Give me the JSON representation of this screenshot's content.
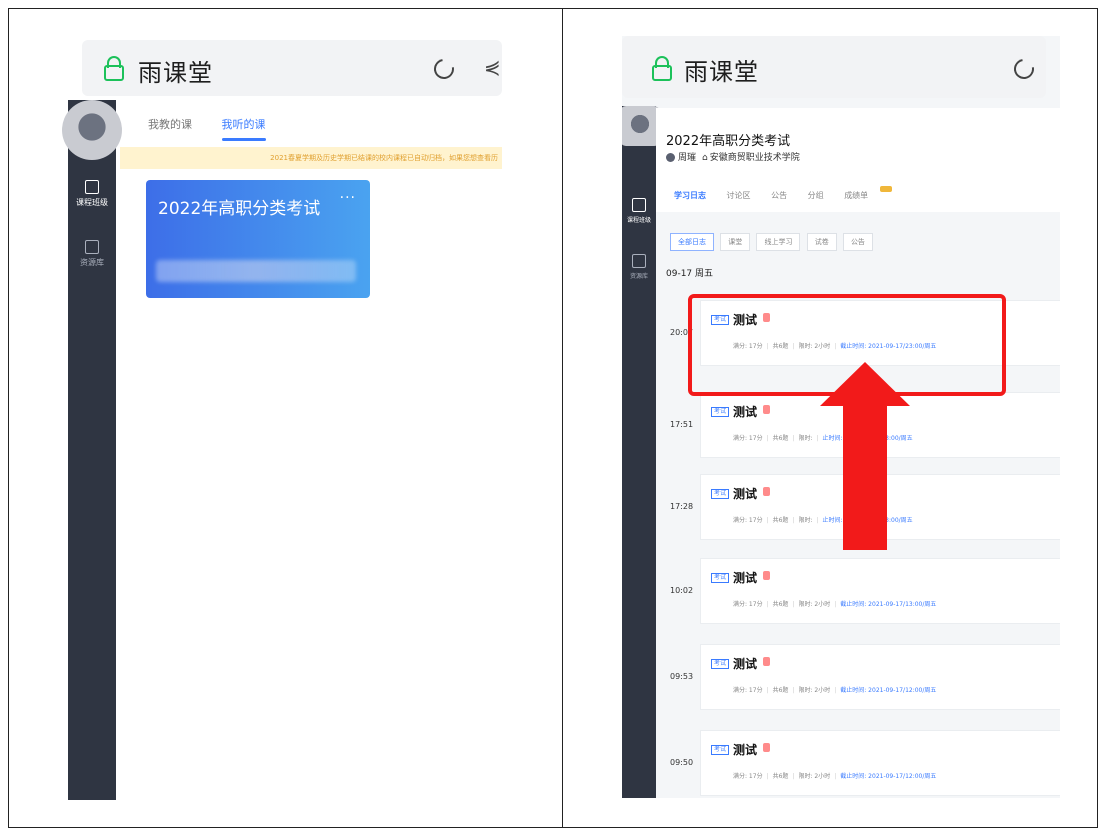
{
  "left": {
    "app_title": "雨课堂",
    "tabs": [
      "我教的课",
      "我听的课"
    ],
    "active_tab": 1,
    "notice": "2021春夏学期及历史学期已结课的校内课程已自动归档，如果您想查看历",
    "sidebar": [
      {
        "label": "课程班级",
        "icon": "class-icon"
      },
      {
        "label": "资源库",
        "icon": "library-icon"
      }
    ],
    "course_card": {
      "title": "2022年高职分类考试",
      "more": "···"
    }
  },
  "right": {
    "app_title": "雨课堂",
    "sidebar": [
      {
        "label": "课程班级",
        "icon": "class-icon"
      },
      {
        "label": "资源库",
        "icon": "library-icon"
      }
    ],
    "course": {
      "name": "2022年高职分类考试",
      "teacher": "周璀",
      "school": "安徽商贸职业技术学院"
    },
    "tabs": [
      "学习日志",
      "讨论区",
      "公告",
      "分组",
      "成绩单"
    ],
    "active_tab": 0,
    "filters": [
      "全部日志",
      "课堂",
      "线上学习",
      "试卷",
      "公告"
    ],
    "active_filter": 0,
    "date_heading": "09-17 周五",
    "entries": [
      {
        "time": "20:07",
        "tag": "考试",
        "title": "测试",
        "full_score": "满分: 17分",
        "questions": "共6题",
        "limit": "限时: 2小时",
        "deadline": "截止时间: 2021-09-17/23:00/周五"
      },
      {
        "time": "17:51",
        "tag": "考试",
        "title": "测试",
        "full_score": "满分: 17分",
        "questions": "共6题",
        "limit": "限时:",
        "deadline": "止时间: 2021-09-17/23:00/周五"
      },
      {
        "time": "17:28",
        "tag": "考试",
        "title": "测试",
        "full_score": "满分: 17分",
        "questions": "共6题",
        "limit": "限时:",
        "deadline": "止时间: 2021-09-17/23:00/周五"
      },
      {
        "time": "10:02",
        "tag": "考试",
        "title": "测试",
        "full_score": "满分: 17分",
        "questions": "共6题",
        "limit": "限时: 2小时",
        "deadline": "截止时间: 2021-09-17/13:00/周五"
      },
      {
        "time": "09:53",
        "tag": "考试",
        "title": "测试",
        "full_score": "满分: 17分",
        "questions": "共6题",
        "limit": "限时: 2小时",
        "deadline": "截止时间: 2021-09-17/12:00/周五"
      },
      {
        "time": "09:50",
        "tag": "考试",
        "title": "测试",
        "full_score": "满分: 17分",
        "questions": "共6题",
        "limit": "限时: 2小时",
        "deadline": "截止时间: 2021-09-17/12:00/周五"
      }
    ]
  },
  "colors": {
    "accent": "#3a7bff",
    "sidebar": "#2f3542",
    "lock": "#1cc15a",
    "highlight": "#f21a1a",
    "arrow": "#f21a1a"
  }
}
